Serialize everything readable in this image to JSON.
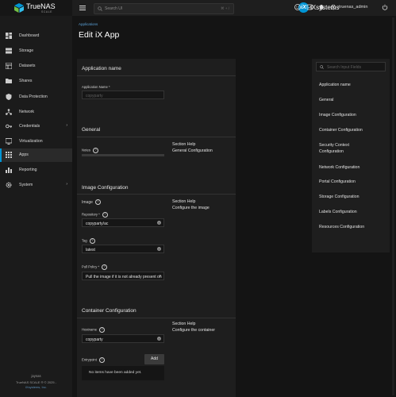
{
  "brand": {
    "name": "TrueNAS",
    "edition": "SCALE"
  },
  "topbar": {
    "search_placeholder": "Search UI",
    "search_shortcut": "⌘ + /",
    "partner_logo": "iXsystems",
    "username": "truenas_admin"
  },
  "sidebar": {
    "items": [
      {
        "label": "Dashboard",
        "icon": "dashboard-icon"
      },
      {
        "label": "Storage",
        "icon": "storage-icon"
      },
      {
        "label": "Datasets",
        "icon": "datasets-icon"
      },
      {
        "label": "Shares",
        "icon": "shares-icon"
      },
      {
        "label": "Data Protection",
        "icon": "shield-icon"
      },
      {
        "label": "Network",
        "icon": "network-icon"
      },
      {
        "label": "Credentials",
        "icon": "key-icon"
      },
      {
        "label": "Virtualization",
        "icon": "monitor-icon"
      },
      {
        "label": "Apps",
        "icon": "apps-icon"
      },
      {
        "label": "Reporting",
        "icon": "chart-icon"
      },
      {
        "label": "System",
        "icon": "gear-icon"
      }
    ],
    "footer_host": "jaynas",
    "footer_version": "TrueNAS SCALE ® © 2025 -",
    "footer_company": "iXsystems, Inc."
  },
  "page": {
    "breadcrumb": "Applications",
    "title": "Edit iX App"
  },
  "sections": {
    "app_name": {
      "title": "Application name",
      "field_label": "Application Name *",
      "field_value": "copyparty"
    },
    "general": {
      "title": "General",
      "notes_label": "Notes",
      "help_title": "Section Help",
      "help_body": "General Configuration"
    },
    "image": {
      "title": "Image Configuration",
      "image_label": "Image",
      "repo_label": "Repository *",
      "repo_value": "copyparty/ac",
      "tag_label": "Tag",
      "tag_value": "latest",
      "pull_label": "Pull Policy *",
      "pull_value": "Pull the image if it is not already present on",
      "help_title": "Section Help",
      "help_body": "Configure the image"
    },
    "container": {
      "title": "Container Configuration",
      "hostname_label": "Hostname",
      "hostname_value": "copyparty",
      "entrypoint_label": "Entrypoint",
      "add_label": "Add",
      "empty_text": "No items have been added yet.",
      "help_title": "Section Help",
      "help_body": "Configure the container"
    }
  },
  "toc": {
    "search_placeholder": "Search Input Fields",
    "items": [
      "Application name",
      "General",
      "Image Configuration",
      "Container Configuration",
      "Security Context",
      "Configuration",
      "Network Configuration",
      "Portal Configuration",
      "Storage Configuration",
      "Labels Configuration",
      "Resources Configuration"
    ]
  },
  "colors": {
    "accent": "#0095d5",
    "background": "#141414",
    "card": "#1e1e1e"
  }
}
